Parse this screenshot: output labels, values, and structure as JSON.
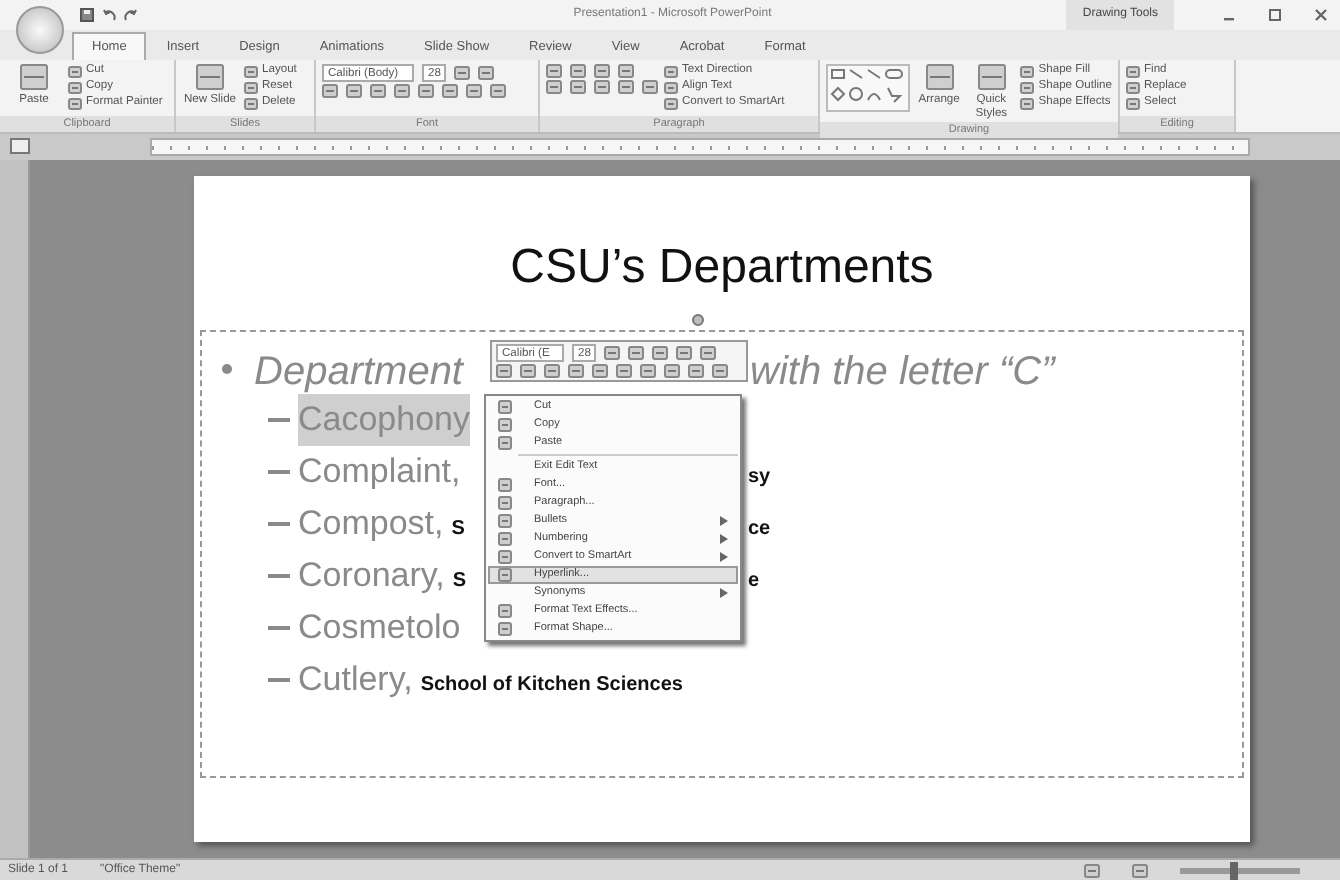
{
  "window": {
    "title": "Presentation1 - Microsoft PowerPoint",
    "context_title": "Drawing Tools"
  },
  "tabs": [
    {
      "label": "Home",
      "selected": true
    },
    {
      "label": "Insert",
      "selected": false
    },
    {
      "label": "Design",
      "selected": false
    },
    {
      "label": "Animations",
      "selected": false
    },
    {
      "label": "Slide Show",
      "selected": false
    },
    {
      "label": "Review",
      "selected": false
    },
    {
      "label": "View",
      "selected": false
    },
    {
      "label": "Acrobat",
      "selected": false
    },
    {
      "label": "Format",
      "selected": false
    }
  ],
  "ribbon": [
    {
      "label": "Clipboard",
      "kind": "clipboard",
      "items": [
        {
          "label": "Paste",
          "kind": "large"
        },
        {
          "label": "Cut",
          "kind": "small"
        },
        {
          "label": "Copy",
          "kind": "small"
        },
        {
          "label": "Format Painter",
          "kind": "small"
        }
      ]
    },
    {
      "label": "Slides",
      "kind": "slides",
      "items": [
        {
          "label": "New Slide",
          "kind": "large"
        },
        {
          "label": "Layout",
          "kind": "small"
        },
        {
          "label": "Reset",
          "kind": "small"
        },
        {
          "label": "Delete",
          "kind": "small"
        }
      ]
    },
    {
      "label": "Font",
      "kind": "font",
      "items": [
        {
          "label": "Calibri (Body)",
          "kind": "field"
        },
        {
          "label": "28",
          "kind": "field"
        }
      ]
    },
    {
      "label": "Paragraph",
      "kind": "paragraph",
      "items": [
        {
          "label": "Text Direction",
          "kind": "small"
        },
        {
          "label": "Align Text",
          "kind": "small"
        },
        {
          "label": "Convert to SmartArt",
          "kind": "small"
        }
      ]
    },
    {
      "label": "Drawing",
      "kind": "drawing",
      "items": [
        {
          "label": "Arrange",
          "kind": "large"
        },
        {
          "label": "Quick Styles",
          "kind": "large"
        },
        {
          "label": "Shape Fill",
          "kind": "small"
        },
        {
          "label": "Shape Outline",
          "kind": "small"
        },
        {
          "label": "Shape Effects",
          "kind": "small"
        }
      ]
    },
    {
      "label": "Editing",
      "kind": "editing",
      "items": [
        {
          "label": "Find",
          "kind": "small"
        },
        {
          "label": "Replace",
          "kind": "small"
        },
        {
          "label": "Select",
          "kind": "small"
        }
      ]
    }
  ],
  "slide": {
    "title": "CSU’s Departments",
    "bullet": {
      "text_before": "Department",
      "text_after": "with the letter “C”"
    },
    "sub_items": [
      {
        "lead": "Cacophony",
        "highlighted": true
      },
      {
        "lead": "Complaint,",
        "tail": "sy",
        "highlighted": false
      },
      {
        "lead": "Compost,",
        "note": "S",
        "tail": "ce",
        "highlighted": false
      },
      {
        "lead": "Coronary,",
        "note": "S",
        "tail": "e",
        "highlighted": false
      },
      {
        "lead": "Cosmetolo",
        "highlighted": false
      },
      {
        "lead": "Cutlery,",
        "note": "School of Kitchen Sciences",
        "highlighted": false
      }
    ]
  },
  "mini_toolbar": {
    "font": "Calibri (E",
    "size": "28"
  },
  "context_menu": [
    {
      "kind": "icon-item",
      "label": "Cut",
      "submenu": false,
      "selected": false
    },
    {
      "kind": "icon-item",
      "label": "Copy",
      "submenu": false,
      "selected": false
    },
    {
      "kind": "icon-item",
      "label": "Paste",
      "submenu": false,
      "selected": false
    },
    {
      "kind": "separator"
    },
    {
      "kind": "item",
      "label": "Exit Edit Text",
      "submenu": false,
      "selected": false
    },
    {
      "kind": "icon-item",
      "label": "Font...",
      "submenu": false,
      "selected": false
    },
    {
      "kind": "icon-item",
      "label": "Paragraph...",
      "submenu": false,
      "selected": false
    },
    {
      "kind": "icon-item",
      "label": "Bullets",
      "submenu": true,
      "selected": false
    },
    {
      "kind": "icon-item",
      "label": "Numbering",
      "submenu": true,
      "selected": false
    },
    {
      "kind": "icon-item",
      "label": "Convert to SmartArt",
      "submenu": true,
      "selected": false
    },
    {
      "kind": "icon-item",
      "label": "Hyperlink...",
      "submenu": false,
      "selected": true
    },
    {
      "kind": "item",
      "label": "Synonyms",
      "submenu": true,
      "selected": false
    },
    {
      "kind": "icon-item",
      "label": "Format Text Effects...",
      "submenu": false,
      "selected": false
    },
    {
      "kind": "icon-item",
      "label": "Format Shape...",
      "submenu": false,
      "selected": false
    }
  ],
  "status_bar": {
    "slide": "Slide 1 of 1",
    "theme": "\"Office Theme\"",
    "zoom_slider": {
      "level": 0.45
    }
  }
}
